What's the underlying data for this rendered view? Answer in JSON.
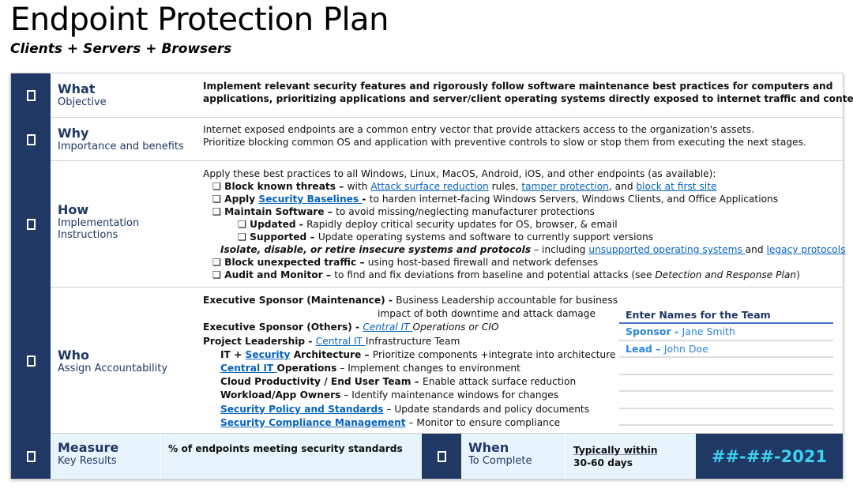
{
  "title": "Endpoint Protection Plan",
  "subtitle": "Clients + Servers + Browsers",
  "colors": {
    "navy": "#1f3864",
    "link": "#0563c1",
    "date": "#3ad0f0",
    "bottom_bg": "#e8f4fd"
  },
  "rows": [
    {
      "icon": "checkbox-icon",
      "heading": "What",
      "sub": "Objective",
      "lines": [
        [
          {
            "t": "Implement relevant security features and rigorously follow software maintenance best practices for computers and",
            "b": true
          }
        ],
        [
          {
            "t": "applications, prioritizing applications and server/client operating systems directly exposed to internet traffic and content",
            "b": true
          }
        ]
      ]
    },
    {
      "icon": "checkbox-icon",
      "heading": "Why",
      "sub": "Importance and benefits",
      "lines": [
        [
          {
            "t": "Internet exposed endpoints are a common entry vector that provide attackers access to the organization's assets."
          }
        ],
        [
          {
            "t": "Prioritize blocking common OS and application with preventive controls to slow or stop them from executing the next stages."
          }
        ]
      ]
    },
    {
      "icon": "checkbox-icon",
      "heading": "How",
      "sub": "Implementation Instructions",
      "lines": [
        [
          {
            "t": "Apply these best practices to all Windows, Linux, MacOS, Android, iOS, and other endpoints (as available):"
          }
        ],
        {
          "ind": 1,
          "cb": true,
          "segs": [
            {
              "t": "Block known threats – ",
              "b": true
            },
            {
              "t": "with "
            },
            {
              "t": "Attack surface reduction",
              "link": true
            },
            {
              "t": " rules, "
            },
            {
              "t": "tamper protection",
              "link": true
            },
            {
              "t": ", and "
            },
            {
              "t": "block at first site",
              "link": true
            }
          ]
        },
        {
          "ind": 1,
          "cb": true,
          "segs": [
            {
              "t": "Apply ",
              "b": true
            },
            {
              "t": "Security Baselines ",
              "link": true,
              "b": true
            },
            {
              "t": "- ",
              "b": true
            },
            {
              "t": "to harden internet-facing Windows Servers, Windows Clients, and Office Applications"
            }
          ]
        },
        {
          "ind": 1,
          "cb": true,
          "segs": [
            {
              "t": "Maintain Software – ",
              "b": true
            },
            {
              "t": "to avoid missing/neglecting manufacturer protections"
            }
          ]
        },
        {
          "ind": 2,
          "cb": true,
          "segs": [
            {
              "t": "Updated - ",
              "b": true
            },
            {
              "t": "Rapidly deploy critical security updates for OS, browser, & email"
            }
          ]
        },
        {
          "ind": 2,
          "cb": true,
          "segs": [
            {
              "t": "Supported – ",
              "b": true
            },
            {
              "t": "Update operating systems and software to currently support versions"
            }
          ]
        },
        {
          "ind": 3,
          "segs": [
            {
              "t": "Isolate, disable, or retire insecure systems and protocols",
              "b": true,
              "i": true
            },
            {
              "t": " – including "
            },
            {
              "t": "unsupported operating systems ",
              "link": true
            },
            {
              "t": "and "
            },
            {
              "t": "legacy protocols",
              "link": true
            }
          ]
        },
        {
          "ind": 1,
          "cb": true,
          "segs": [
            {
              "t": "Block unexpected traffic – ",
              "b": true
            },
            {
              "t": "using host-based firewall and network defenses"
            }
          ]
        },
        {
          "ind": 1,
          "cb": true,
          "segs": [
            {
              "t": "Audit and Monitor – ",
              "b": true
            },
            {
              "t": "to find and fix deviations from baseline and potential attacks (see "
            },
            {
              "t": "Detection and Response Plan",
              "i": true
            },
            {
              "t": ")"
            }
          ]
        }
      ]
    },
    {
      "icon": "checkbox-icon",
      "heading": "Who",
      "sub": "Assign Accountability",
      "lines": [
        [
          {
            "t": "Executive Sponsor (Maintenance) - ",
            "b": true
          },
          {
            "t": "Business Leadership accountable for business"
          }
        ],
        {
          "ind": 4,
          "segs": [
            {
              "t": "impact of both downtime and attack damage"
            }
          ]
        },
        [
          {
            "t": "Executive Sponsor (Others) - ",
            "b": true
          },
          {
            "t": "Central IT ",
            "link": true,
            "i": true
          },
          {
            "t": "Operations or CIO",
            "i": true
          }
        ],
        [
          {
            "t": "Project Leadership - ",
            "b": true
          },
          {
            "t": "Central IT ",
            "link": true
          },
          {
            "t": "Infrastructure Team"
          }
        ],
        {
          "ind": 3,
          "segs": [
            {
              "t": "IT + ",
              "b": true
            },
            {
              "t": "Security",
              "link": true,
              "b": true
            },
            {
              "t": " Architecture – ",
              "b": true
            },
            {
              "t": "Prioritize components +integrate into architecture"
            }
          ]
        },
        {
          "ind": 3,
          "segs": [
            {
              "t": "Central IT ",
              "link": true,
              "b": true
            },
            {
              "t": "Operations",
              "b": true
            },
            {
              "t": " – Implement changes to environment"
            }
          ]
        },
        {
          "ind": 3,
          "segs": [
            {
              "t": "Cloud Productivity / End User Team – ",
              "b": true
            },
            {
              "t": "Enable attack surface reduction"
            }
          ]
        },
        {
          "ind": 3,
          "segs": [
            {
              "t": "Workload/App Owners",
              "b": true
            },
            {
              "t": " – Identify maintenance windows for changes"
            }
          ]
        },
        {
          "ind": 3,
          "segs": [
            {
              "t": "Security Policy and Standards",
              "link": true,
              "b": true
            },
            {
              "t": " – Update standards and policy documents"
            }
          ]
        },
        {
          "ind": 3,
          "segs": [
            {
              "t": "Security Compliance Management",
              "link": true,
              "b": true
            },
            {
              "t": " – Monitor to ensure compliance"
            }
          ]
        }
      ]
    }
  ],
  "team": {
    "header": "Enter Names for the Team",
    "entries": [
      {
        "role": "Sponsor - ",
        "name": "Jane Smith"
      },
      {
        "role": "Lead – ",
        "name": "John Doe"
      },
      {
        "role": "",
        "name": ""
      },
      {
        "role": "",
        "name": ""
      },
      {
        "role": "",
        "name": ""
      },
      {
        "role": "",
        "name": ""
      }
    ]
  },
  "measure": {
    "icon": "checkbox-icon",
    "heading": "Measure",
    "sub": "Key Results",
    "text": "% of endpoints meeting security standards"
  },
  "when": {
    "icon": "checkbox-icon",
    "heading": "When",
    "sub": "To Complete",
    "line1": "Typically within",
    "line2": "30-60 days",
    "date": "##-##-2021"
  }
}
